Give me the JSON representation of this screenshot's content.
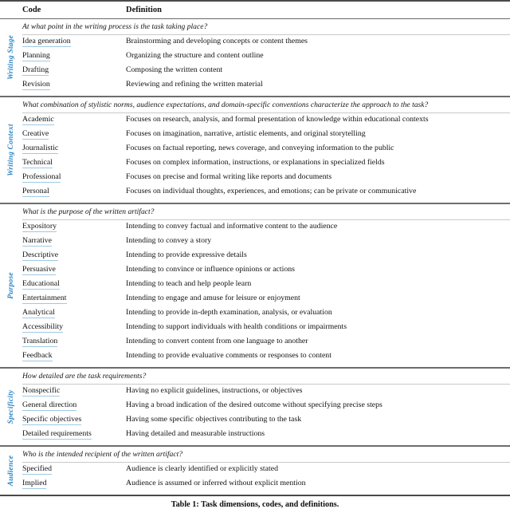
{
  "table": {
    "columns": {
      "code": "Code",
      "definition": "Definition"
    },
    "caption": "Table 1: Task dimensions, codes, and definitions.",
    "accent_color": "#2d86c4",
    "underline_color": "#9ec9e4",
    "sections": [
      {
        "label": "Writing Stage",
        "question": "At what point in the writing process is the task taking place?",
        "rows": [
          {
            "code": "Idea generation",
            "definition": "Brainstorming and developing concepts or content themes"
          },
          {
            "code": "Planning",
            "definition": "Organizing the structure and content outline"
          },
          {
            "code": "Drafting",
            "definition": "Composing the written content"
          },
          {
            "code": "Revision",
            "definition": "Reviewing and refining the written material"
          }
        ]
      },
      {
        "label": "Writing Context",
        "question": "What combination of stylistic norms, audience expectations, and domain-specific conventions characterize the approach to the task?",
        "rows": [
          {
            "code": "Academic",
            "definition": "Focuses on research, analysis, and formal presentation of knowledge within educational contexts"
          },
          {
            "code": "Creative",
            "definition": "Focuses on imagination, narrative, artistic elements, and original storytelling"
          },
          {
            "code": "Journalistic",
            "definition": "Focuses on factual reporting, news coverage, and conveying information to the public"
          },
          {
            "code": "Technical",
            "definition": "Focuses on complex information, instructions, or explanations in specialized fields"
          },
          {
            "code": "Professional",
            "definition": "Focuses on precise and formal writing like reports and documents"
          },
          {
            "code": "Personal",
            "definition": "Focuses on individual thoughts, experiences, and emotions; can be private or communicative"
          }
        ]
      },
      {
        "label": "Purpose",
        "question": "What is the purpose of the written artifact?",
        "rows": [
          {
            "code": "Expository",
            "definition": "Intending to convey factual and informative content to the audience"
          },
          {
            "code": "Narrative",
            "definition": "Intending to convey a story"
          },
          {
            "code": "Descriptive",
            "definition": "Intending to provide expressive details"
          },
          {
            "code": "Persuasive",
            "definition": "Intending to convince or influence opinions or actions"
          },
          {
            "code": "Educational",
            "definition": "Intending to teach and help people learn"
          },
          {
            "code": "Entertainment",
            "definition": "Intending to engage and amuse for leisure or enjoyment"
          },
          {
            "code": "Analytical",
            "definition": "Intending to provide in-depth examination, analysis, or evaluation"
          },
          {
            "code": "Accessibility",
            "definition": "Intending to support individuals with health conditions or impairments"
          },
          {
            "code": "Translation",
            "definition": "Intending to convert content from one language to another"
          },
          {
            "code": "Feedback",
            "definition": "Intending to provide evaluative comments or responses to content"
          }
        ]
      },
      {
        "label": "Specificity",
        "question": "How detailed are the task requirements?",
        "rows": [
          {
            "code": "Nonspecific",
            "definition": "Having no explicit guidelines, instructions, or objectives"
          },
          {
            "code": "General direction",
            "definition": "Having a broad indication of the desired outcome without specifying precise steps"
          },
          {
            "code": "Specific objectives",
            "definition": "Having some specific objectives contributing to the task"
          },
          {
            "code": "Detailed requirements",
            "definition": "Having detailed and measurable instructions"
          }
        ]
      },
      {
        "label": "Audience",
        "question": "Who is the intended recipient of the written artifact?",
        "rows": [
          {
            "code": "Specified",
            "definition": "Audience is clearly identified or explicitly stated"
          },
          {
            "code": "Implied",
            "definition": "Audience is assumed or inferred without explicit mention"
          }
        ]
      }
    ]
  }
}
